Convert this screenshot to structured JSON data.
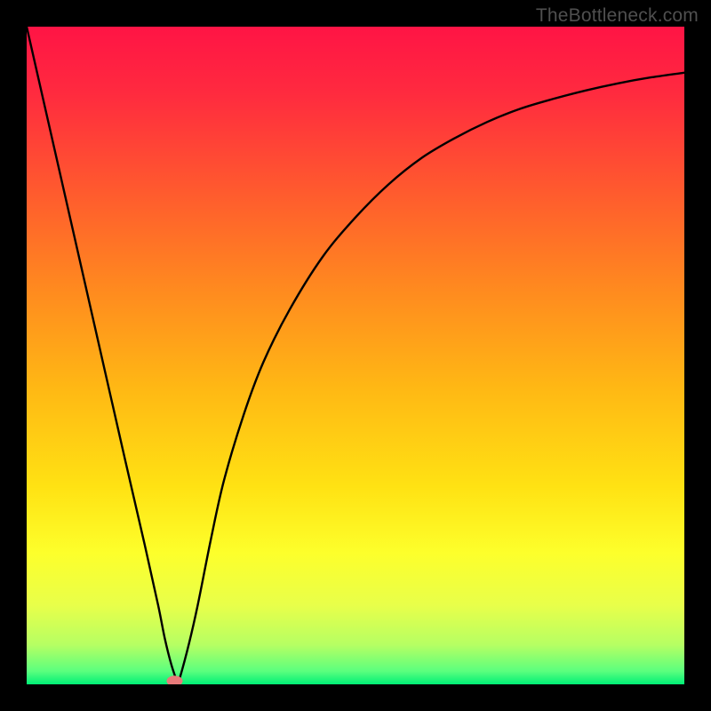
{
  "watermark": "TheBottleneck.com",
  "chart_data": {
    "type": "line",
    "title": "",
    "xlabel": "",
    "ylabel": "",
    "xlim": [
      0,
      100
    ],
    "ylim": [
      0,
      100
    ],
    "series": [
      {
        "name": "bottleneck-curve",
        "x": [
          0,
          5,
          10,
          15,
          18,
          20,
          21,
          22,
          23,
          24,
          26,
          28,
          30,
          33,
          36,
          40,
          45,
          50,
          55,
          60,
          65,
          70,
          75,
          80,
          85,
          90,
          95,
          100
        ],
        "values": [
          100,
          78,
          56,
          34,
          21,
          12,
          7,
          3,
          0,
          3,
          12,
          22,
          31,
          41,
          49,
          57,
          65,
          71,
          76,
          80,
          83,
          85.5,
          87.5,
          89,
          90.3,
          91.4,
          92.3,
          93
        ]
      }
    ],
    "background": {
      "gradient_stops": [
        {
          "pos": 0.0,
          "color": "#ff1445"
        },
        {
          "pos": 0.1,
          "color": "#ff2a3f"
        },
        {
          "pos": 0.25,
          "color": "#ff5a2e"
        },
        {
          "pos": 0.4,
          "color": "#ff8a1f"
        },
        {
          "pos": 0.55,
          "color": "#ffb814"
        },
        {
          "pos": 0.7,
          "color": "#ffe213"
        },
        {
          "pos": 0.8,
          "color": "#fdff2b"
        },
        {
          "pos": 0.88,
          "color": "#e8ff4a"
        },
        {
          "pos": 0.94,
          "color": "#b6ff63"
        },
        {
          "pos": 0.98,
          "color": "#5bff7e"
        },
        {
          "pos": 1.0,
          "color": "#00ef76"
        }
      ]
    },
    "marker": {
      "x": 22.5,
      "y": 0.5,
      "color": "#e77a7a"
    }
  }
}
